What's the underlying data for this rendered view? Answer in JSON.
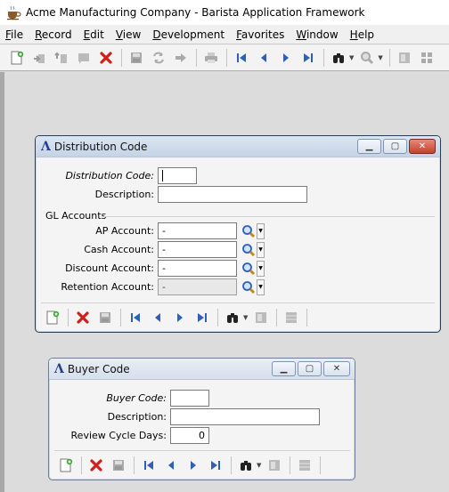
{
  "app": {
    "title": "Acme Manufacturing Company - Barista Application Framework",
    "menu": [
      "File",
      "Record",
      "Edit",
      "View",
      "Development",
      "Favorites",
      "Window",
      "Help"
    ]
  },
  "toolbar_icons": [
    "new-record-icon",
    "insert-icon",
    "insert-before-icon",
    "copy-icon",
    "delete-icon",
    "save-icon",
    "refresh-icon",
    "forward-icon",
    "print-icon",
    "first-record-icon",
    "previous-record-icon",
    "next-record-icon",
    "last-record-icon",
    "binoculars-icon",
    "zoom-icon",
    "grid-icon",
    "more-icon"
  ],
  "distribution_window": {
    "title": "Distribution Code",
    "logo": "Λ",
    "fields": {
      "code_label": "Distribution Code:",
      "code_value": "",
      "description_label": "Description:",
      "description_value": ""
    },
    "section_label": "GL Accounts",
    "accounts": [
      {
        "label": "AP Account:",
        "value": "-",
        "disabled": false
      },
      {
        "label": "Cash Account:",
        "value": "-",
        "disabled": false
      },
      {
        "label": "Discount Account:",
        "value": "-",
        "disabled": false
      },
      {
        "label": "Retention Account:",
        "value": "-",
        "disabled": true
      }
    ]
  },
  "buyer_window": {
    "title": "Buyer Code",
    "logo": "Λ",
    "fields": {
      "code_label": "Buyer Code:",
      "code_value": "",
      "description_label": "Description:",
      "description_value": "",
      "review_label": "Review Cycle Days:",
      "review_value": "0"
    }
  },
  "colors": {
    "accent_blue": "#2f5fb8",
    "delete_red": "#d0201b",
    "workspace": "#dcdcdc"
  }
}
